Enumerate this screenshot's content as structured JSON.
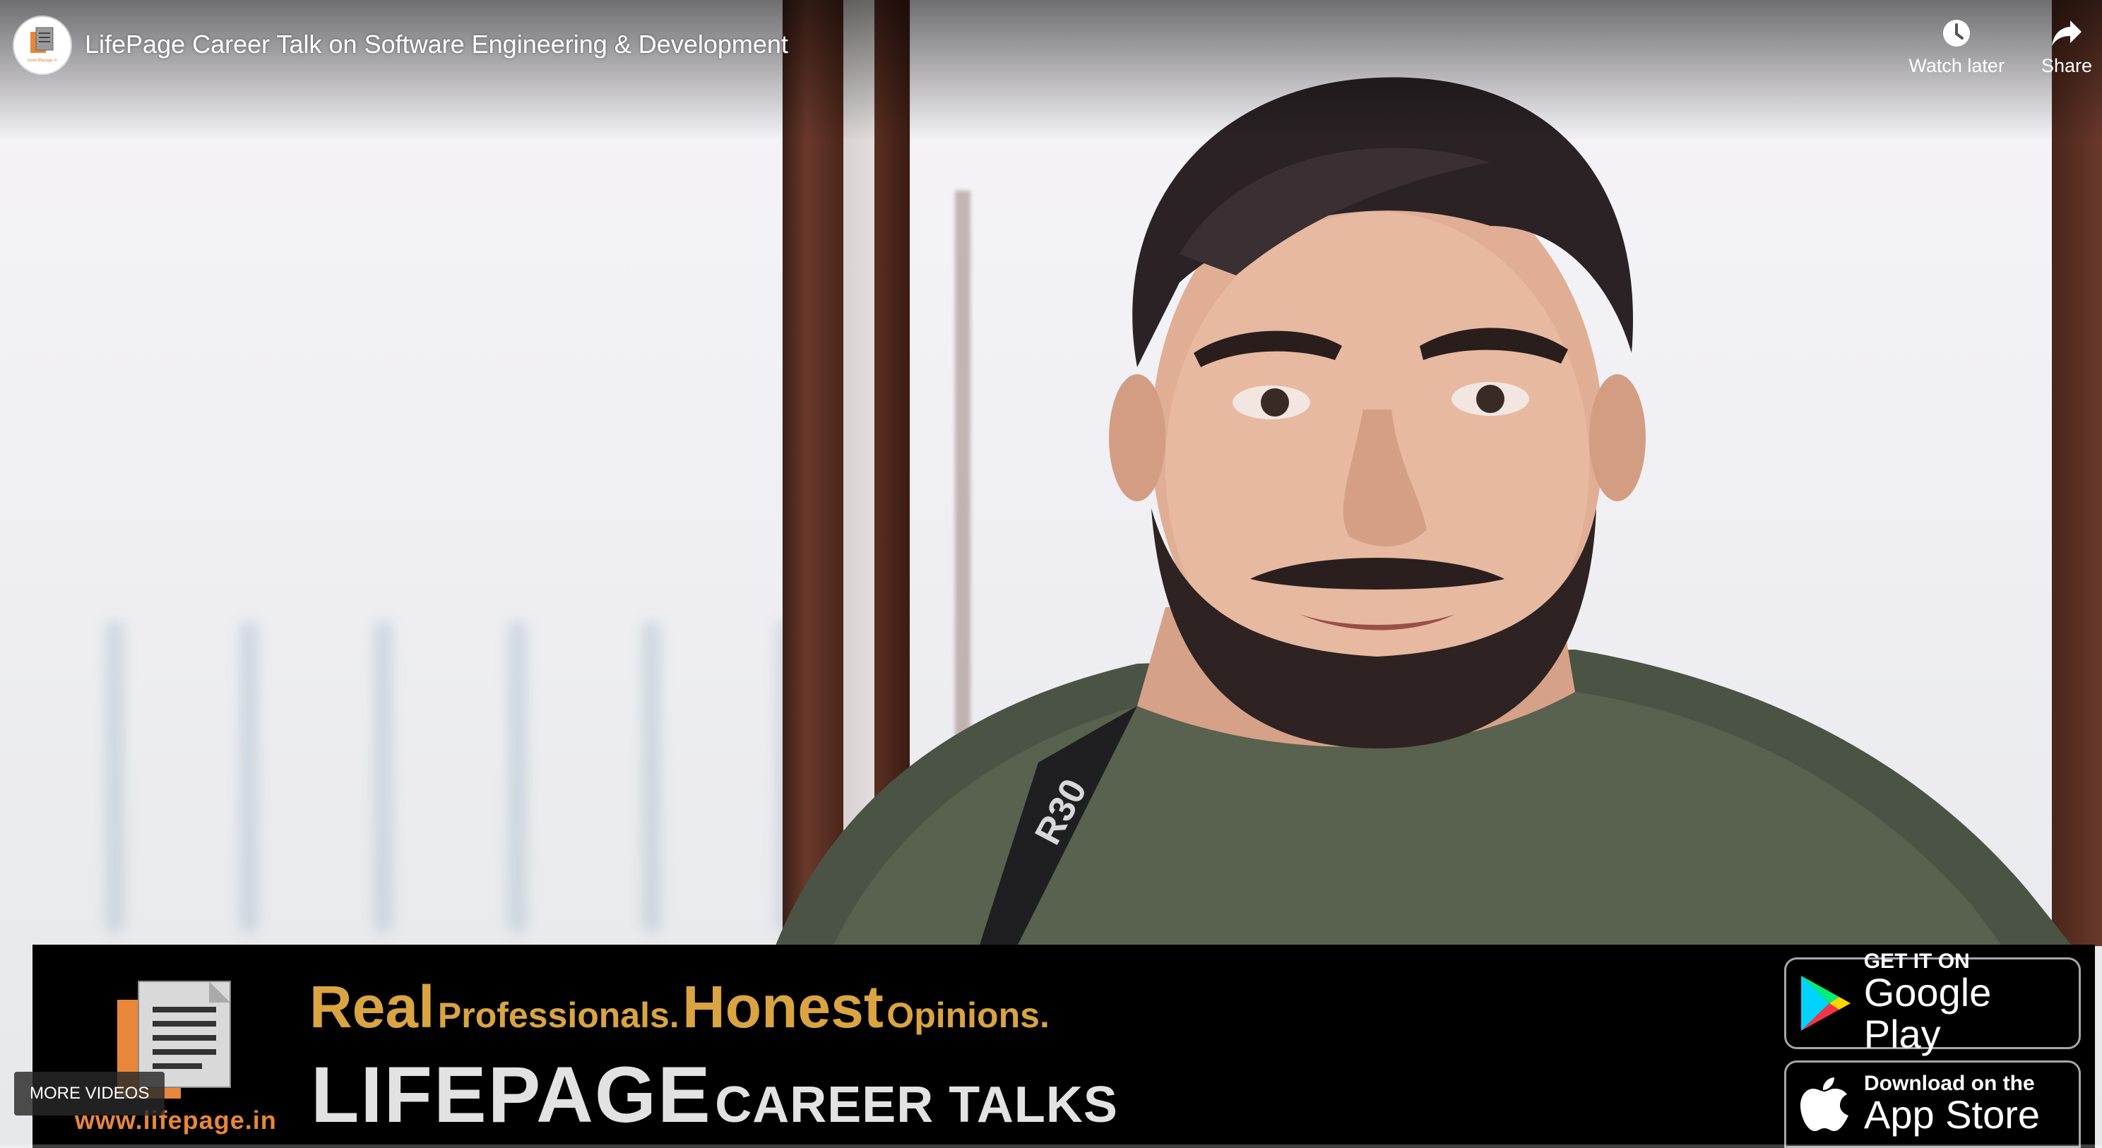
{
  "header": {
    "title": "LifePage Career Talk on Software Engineering & Development",
    "watch_later_label": "Watch later",
    "share_label": "Share",
    "channel_logo_text": "www.lifepage.in"
  },
  "banner": {
    "tagline_word1": "Real",
    "tagline_word2": "Professionals.",
    "tagline_word3": "Honest",
    "tagline_word4": "Opinions.",
    "brand_main": "LIFEPAGE",
    "brand_sub": "CAREER TALKS",
    "url": "www.lifepage.in",
    "google_play_small": "GET IT ON",
    "google_play_big": "Google Play",
    "app_store_small": "Download on the",
    "app_store_big": "App Store"
  },
  "controls": {
    "more_videos_label": "MORE VIDEOS",
    "progress_fraction": 0.0
  },
  "colors": {
    "accent_gold": "#d9a441",
    "brand_orange": "#e8873a",
    "progress_red": "#ff0000"
  }
}
